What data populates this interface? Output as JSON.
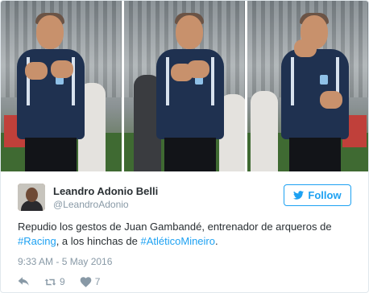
{
  "media": {
    "photos": [
      {
        "alt_name": "coach-gesture-photo-1"
      },
      {
        "alt_name": "coach-gesture-photo-2"
      },
      {
        "alt_name": "coach-gesture-photo-3"
      }
    ]
  },
  "author": {
    "display_name": "Leandro Adonio Belli",
    "handle": "@LeandroAdonio"
  },
  "follow_button": {
    "label": "Follow",
    "icon": "twitter-bird-icon",
    "color": "#1da1f2"
  },
  "tweet": {
    "text_part1": "Repudio los gestos de Juan Gambandé, entrenador de arqueros de ",
    "hashtag1": "#Racing",
    "text_part2": ", a los hinchas de ",
    "hashtag2": "#AtléticoMineiro",
    "text_part3": ".",
    "timestamp": "9:33 AM - 5 May 2016"
  },
  "actions": {
    "reply": {
      "icon": "reply-icon"
    },
    "retweet": {
      "icon": "retweet-icon",
      "count": "9"
    },
    "like": {
      "icon": "heart-icon",
      "count": "7"
    }
  },
  "colors": {
    "text": "#292f33",
    "muted": "#8899a6",
    "link": "#1da1f2"
  }
}
